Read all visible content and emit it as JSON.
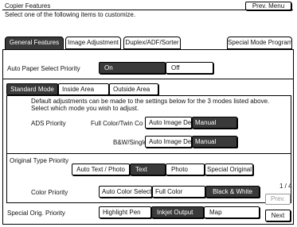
{
  "header": {
    "title": "Copier Features",
    "instruction": "Select one of the following items to customize.",
    "prev_menu": "Prev. Menu"
  },
  "tabs": [
    {
      "label": "General Features",
      "selected": true
    },
    {
      "label": "Image Adjustment",
      "selected": false
    },
    {
      "label": "Duplex/ADF/Sorter",
      "selected": false
    },
    {
      "label": "Special Mode Program(s)",
      "selected": false
    }
  ],
  "auto_paper": {
    "label": "Auto Paper Select Priority",
    "on": "On",
    "off": "Off",
    "selected": "On"
  },
  "modes": {
    "tabs": [
      "Standard Mode",
      "Inside Area",
      "Outside Area"
    ],
    "selected": "Standard Mode",
    "desc_line1": "Default adjustments can be made to the settings below for the 3 modes listed above.",
    "desc_line2": "Select which mode you wish to adjust."
  },
  "ads": {
    "label": "ADS Priority",
    "rows": [
      {
        "mode": "Full Color/Twin Color",
        "auto": "Auto Image Density",
        "manual": "Manual",
        "selected": "Manual"
      },
      {
        "mode": "B&W/Single",
        "auto": "Auto Image Density",
        "manual": "Manual",
        "selected": "Manual"
      }
    ]
  },
  "original_type": {
    "label": "Original Type Priority",
    "options": [
      "Auto Text / Photo",
      "Text",
      "Photo",
      "Special Original"
    ],
    "selected": "Text"
  },
  "color_priority": {
    "label": "Color Priority",
    "options": [
      "Auto Color Select",
      "Full Color",
      "Black & White"
    ],
    "selected": "Black & White"
  },
  "special_orig": {
    "label": "Special Orig. Priority",
    "options": [
      "Highlight Pen",
      "Inkjet Output",
      "Map"
    ],
    "selected": "Inkjet Output"
  },
  "pager": {
    "page": "1 / 4",
    "prev": "Prev.",
    "next": "Next"
  }
}
